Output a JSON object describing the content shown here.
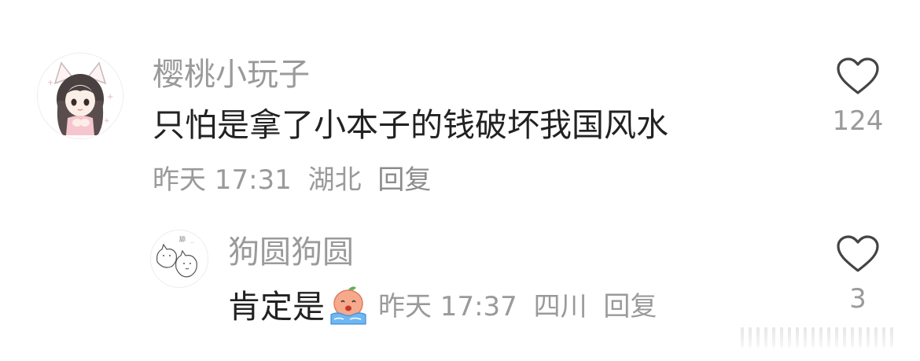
{
  "comments": [
    {
      "user": "樱桃小玩子",
      "content": "只怕是拿了小本子的钱破坏我国风水",
      "time": "昨天 17:31",
      "location": "湖北",
      "reply_label": "回复",
      "likes": "124",
      "avatar_icon": "girl-with-cat-ears-avatar"
    }
  ],
  "replies": [
    {
      "user": "狗圆狗圆",
      "content": "肯定是",
      "emoji": "crying-face-emoji",
      "time": "昨天 17:37",
      "location": "四川",
      "reply_label": "回复",
      "likes": "3",
      "avatar_icon": "doodle-cats-avatar"
    }
  ]
}
